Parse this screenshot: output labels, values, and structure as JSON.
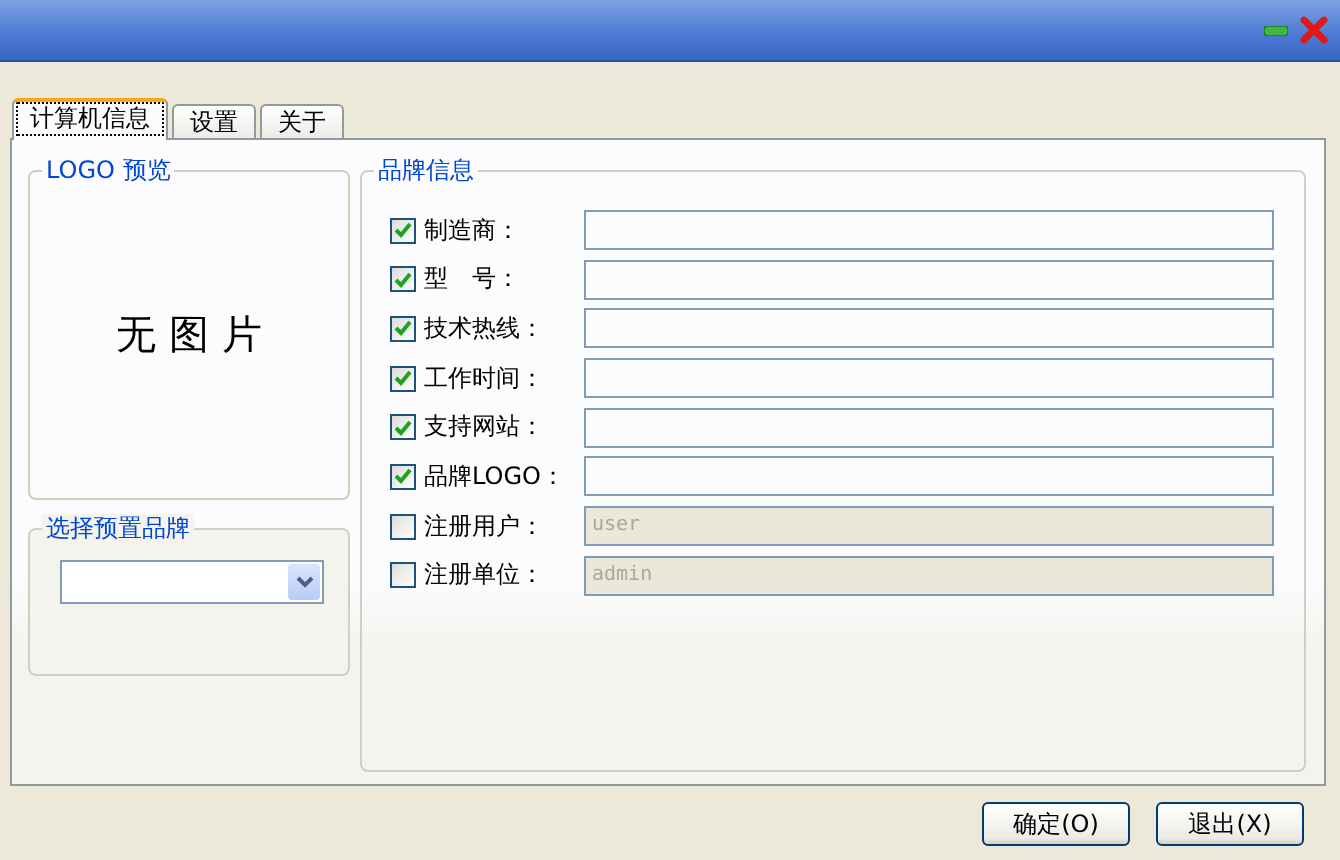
{
  "window": {
    "controls": [
      {
        "kind": "minimize"
      },
      {
        "kind": "close"
      }
    ]
  },
  "tabs": [
    {
      "label": "计算机信息",
      "selected": true
    },
    {
      "label": "设置",
      "selected": false
    },
    {
      "label": "关于",
      "selected": false
    }
  ],
  "logo_preview": {
    "title": "LOGO 预览",
    "message": "无 图 片"
  },
  "preset_brand": {
    "title": "选择预置品牌"
  },
  "brand_info": {
    "title": "品牌信息",
    "fields": [
      {
        "label": "制造商：",
        "checked": true,
        "disabled": false
      },
      {
        "label": "型　号：",
        "checked": true,
        "disabled": false
      },
      {
        "label": "技术热线：",
        "checked": true,
        "disabled": false
      },
      {
        "label": "工作时间：",
        "checked": true,
        "disabled": false
      },
      {
        "label": "支持网站：",
        "checked": true,
        "disabled": false
      },
      {
        "label": "品牌LOGO：",
        "checked": true,
        "disabled": false
      },
      {
        "label": "注册用户：",
        "checked": false,
        "disabled": true,
        "value": "user"
      },
      {
        "label": "注册单位：",
        "checked": false,
        "disabled": true,
        "value": "admin"
      }
    ]
  },
  "buttons": [
    "确定(O)",
    "退出(X)"
  ]
}
